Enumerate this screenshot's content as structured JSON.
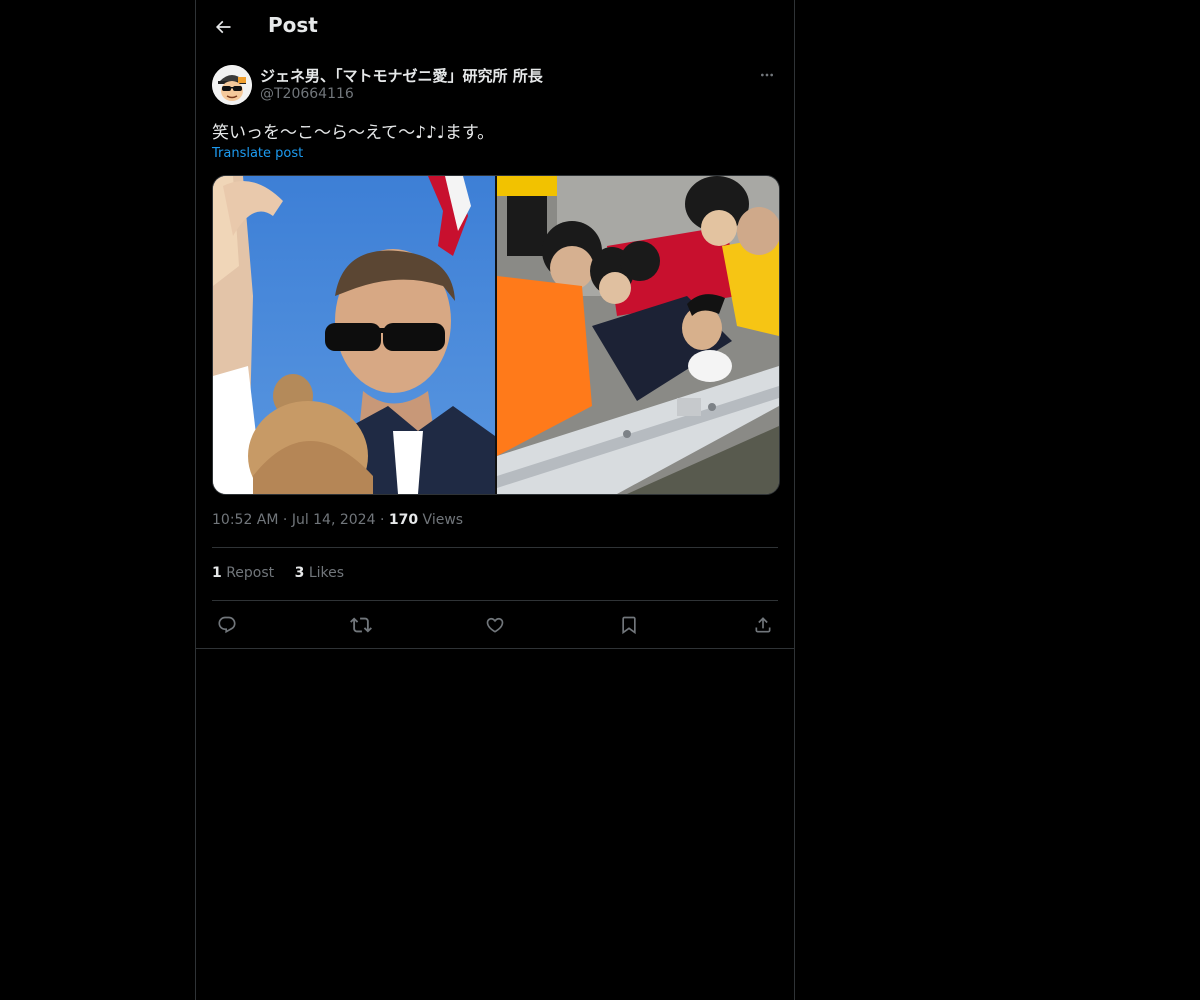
{
  "header": {
    "title": "Post",
    "back_icon": "arrow-left-icon"
  },
  "post": {
    "author": {
      "display_name": "ジェネ男、「マトモナゼニ愛」研究所 所長",
      "handle": "@T20664116",
      "avatar_icon": "cartoon-avatar-with-cap-and-sunglasses"
    },
    "text": "笑いっを〜こ〜ら〜えて〜♪♪♩ます。",
    "translate_label": "Translate post",
    "media": [
      {
        "description_icon": "photo-secret-service-agent"
      },
      {
        "description_icon": "photo-crowd-at-guardrail"
      }
    ],
    "time": "10:52 AM",
    "date": "Jul 14, 2024",
    "views_count": "170",
    "views_label": "Views",
    "reposts_count": "1",
    "reposts_label": "Repost",
    "likes_count": "3",
    "likes_label": "Likes"
  },
  "actions": [
    "reply-icon",
    "repost-icon",
    "like-icon",
    "bookmark-icon",
    "share-icon"
  ],
  "colors": {
    "background": "#000000",
    "text": "#e7e9ea",
    "muted": "#71767b",
    "link": "#1d9bf0",
    "border": "#2f3336"
  }
}
